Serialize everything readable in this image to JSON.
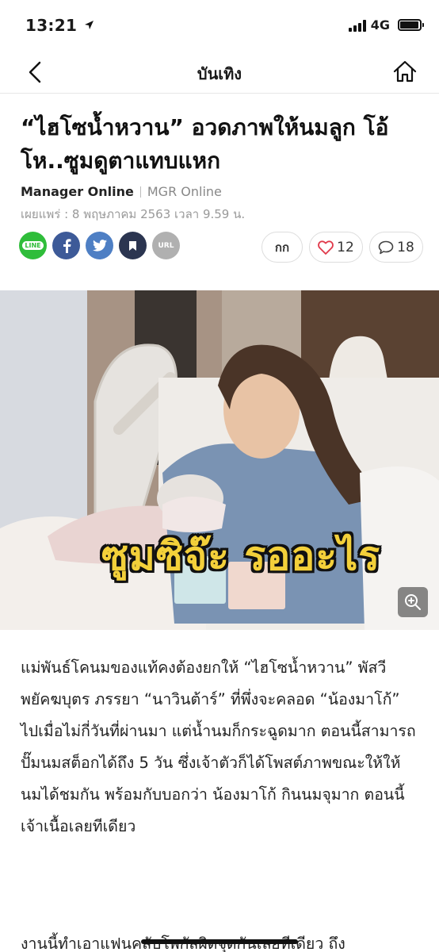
{
  "status": {
    "time": "13:21",
    "network": "4G"
  },
  "nav": {
    "title": "บันเทิง"
  },
  "article": {
    "headline": "“ไฮโซน้ำหวาน” อวดภาพให้นมลูก โอ้โห..ซูมดูตาแทบแหก",
    "source": "Manager Online",
    "brand": "MGR Online",
    "published": "เผยแพร่ : 8 พฤษภาคม 2563 เวลา 9.59 น.",
    "image_caption": "ซูมซิจ๊ะ รออะไร",
    "body": "แม่พันธ์โคนมของแท้คงต้องยกให้ “ไฮโซน้ำหวาน” พัสวี พยัคฆบุตร ภรรยา “นาวินต้าร์” ที่พึ่งจะคลอด “น้องมาโก้” ไปเมื่อไม่กี่วันที่ผ่านมา แต่น้ำนมก็กระฉูดมาก ตอนนี้สามารถปั๊มนมสต็อกได้ถึง 5 วัน ซึ่งเจ้าตัวก็ได้โพสต์ภาพขณะให้ให้นมได้ชมกัน พร้อมกับบอกว่า น้องมาโก้ กินนมจุมาก ตอนนี้เจ้าเนื้อเลยทีเดียว",
    "body2": "งานนี้ทำเอาแฟนคลับโพกัสผิดจุดกันเลยทีเดียว ถึง"
  },
  "share": {
    "line": "LINE",
    "url": "URL"
  },
  "actions": {
    "font_label": "กก",
    "likes": "12",
    "comments": "18"
  },
  "icons": [
    "back-icon",
    "home-icon",
    "line-icon",
    "facebook-icon",
    "twitter-icon",
    "bookmark-icon",
    "url-icon",
    "heart-icon",
    "comment-icon",
    "zoom-icon"
  ]
}
